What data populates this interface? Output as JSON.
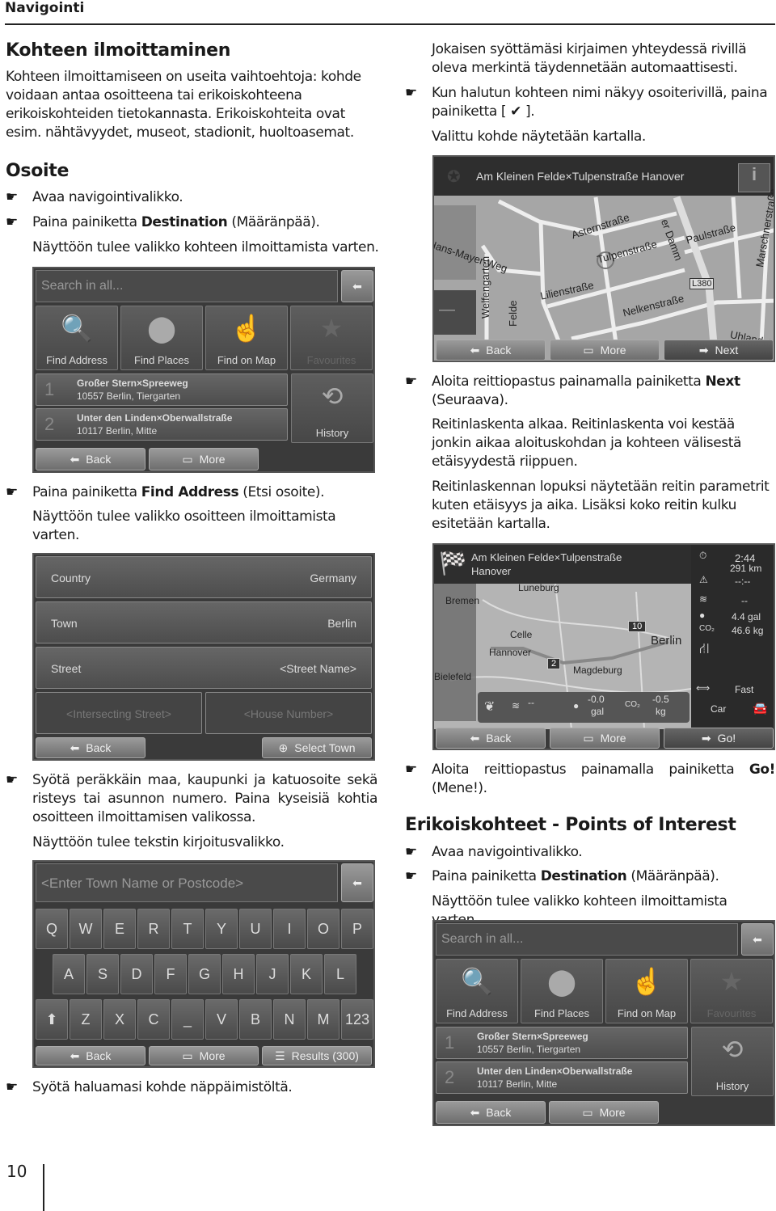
{
  "header": "Navigointi",
  "page_number": "10",
  "left": {
    "h1": "Kohteen ilmoittaminen",
    "intro": "Kohteen ilmoittamiseen on useita vaihtoehtoja: kohde voidaan antaa osoitteena tai erikoiskohteena erikoiskohteiden tietokannasta. Erikoiskohteita ovat esim. nähtävyydet, museot, stadionit, huoltoasemat.",
    "h2": "Osoite",
    "b1": "Avaa navigointivalikko.",
    "b2_pre": "Paina painiketta ",
    "b2_bold": "Destination",
    "b2_post": " (Määränpää).",
    "p1": "Näyttöön tulee valikko kohteen ilmoittamista varten.",
    "b3_pre": "Paina painiketta ",
    "b3_bold": "Find Address",
    "b3_post": " (Etsi osoite).",
    "p2": "Näyttöön tulee valikko osoitteen ilmoittamista varten.",
    "b4": "Syötä peräkkäin maa, kaupunki ja katuosoite sekä risteys tai asunnon numero. Paina kyseisiä kohtia osoitteen ilmoittamisen valikossa.",
    "p3": "Näyttöön tulee tekstin kirjoitusvalikko.",
    "b5": "Syötä haluamasi kohde näppäimistöltä."
  },
  "right": {
    "p1": "Jokaisen syöttämäsi kirjaimen yhteydessä rivillä oleva merkintä täydennetään automaattisesti.",
    "b1_pre": "Kun halutun kohteen nimi näkyy osoiterivillä, paina painiketta [ ",
    "b1_post": " ].",
    "p2": "Valittu kohde näytetään kartalla.",
    "b2_pre": "Aloita reittiopastus painamalla painiketta ",
    "b2_bold": "Next",
    "b2_post": " (Seuraava).",
    "p3": "Reitinlaskenta alkaa. Reitinlaskenta voi kestää jonkin aikaa aloituskohdan ja kohteen välisestä etäisyydestä riippuen.",
    "p4": "Reitinlaskennan lopuksi näytetään reitin parametrit kuten etäisyys ja aika. Lisäksi koko reitin kulku esitetään kartalla.",
    "b3_pre": "Aloita reittiopastus painamalla painiketta ",
    "b3_bold": "Go!",
    "b3_post": " (Mene!).",
    "h2": "Erikoiskohteet - Points of Interest",
    "b4": "Avaa navigointivalikko.",
    "b5_pre": "Paina painiketta ",
    "b5_bold": "Destination",
    "b5_post": " (Määränpää).",
    "p5": "Näyttöön tulee valikko kohteen ilmoittamista varten."
  },
  "menu": {
    "search_placeholder": "Search in all...",
    "tiles": [
      "Find Address",
      "Find Places",
      "Find on Map",
      "Favourites"
    ],
    "history": [
      {
        "num": "1",
        "title": "Großer Stern×Spreeweg",
        "sub": "10557 Berlin, Tiergarten"
      },
      {
        "num": "2",
        "title": "Unter den Linden×Oberwallstraße",
        "sub": "10117 Berlin, Mitte"
      }
    ],
    "history_label": "History",
    "back": "Back",
    "more": "More"
  },
  "address": {
    "rows": [
      {
        "label": "Country",
        "value": "Germany"
      },
      {
        "label": "Town",
        "value": "Berlin"
      },
      {
        "label": "Street",
        "value": "<Street Name>"
      }
    ],
    "intersecting": "<Intersecting Street>",
    "house": "<House Number>",
    "back": "Back",
    "select_town": "Select Town"
  },
  "keyboard": {
    "placeholder": "<Enter Town Name or Postcode>",
    "row1": [
      "Q",
      "W",
      "E",
      "R",
      "T",
      "Y",
      "U",
      "I",
      "O",
      "P"
    ],
    "row2": [
      "A",
      "S",
      "D",
      "F",
      "G",
      "H",
      "J",
      "K",
      "L"
    ],
    "row3": [
      "Z",
      "X",
      "C",
      "_",
      "V",
      "B",
      "N",
      "M",
      "123"
    ],
    "back": "Back",
    "more": "More",
    "results": "Results (300)"
  },
  "map": {
    "title": "Am Kleinen Felde×Tulpenstraße Hanover",
    "streets": [
      "Asternstraße",
      "Tulpenstraße",
      "Paulstraße",
      "Hans-Mayer-Weg",
      "Lilienstraße",
      "Nelkenstraße",
      "Welfengarten",
      "Felde",
      "Uhlandstr",
      "Marschnerstraße",
      "er Damm",
      "L380"
    ],
    "back": "Back",
    "more": "More",
    "next": "Next"
  },
  "route": {
    "title1": "Am Kleinen Felde×Tulpenstraße",
    "title2": "Hanover",
    "time": "2:44",
    "distance": "291 km",
    "toll": "--:--",
    "dash": "--",
    "fuel": "4.4 gal",
    "co2": "46.6 kg",
    "mode": "Fast",
    "vehicle": "Car",
    "cities": [
      "Luneburg",
      "Bremen",
      "Celle",
      "Hannover",
      "Berlin",
      "Magdeburg",
      "Bielefeld"
    ],
    "roads": [
      "10",
      "2"
    ],
    "eco": {
      "dash": "--",
      "fuel": "-0.0",
      "fuel_unit": "gal",
      "co2": "-0.5",
      "co2_unit": "kg"
    },
    "back": "Back",
    "more": "More",
    "go": "Go!"
  }
}
